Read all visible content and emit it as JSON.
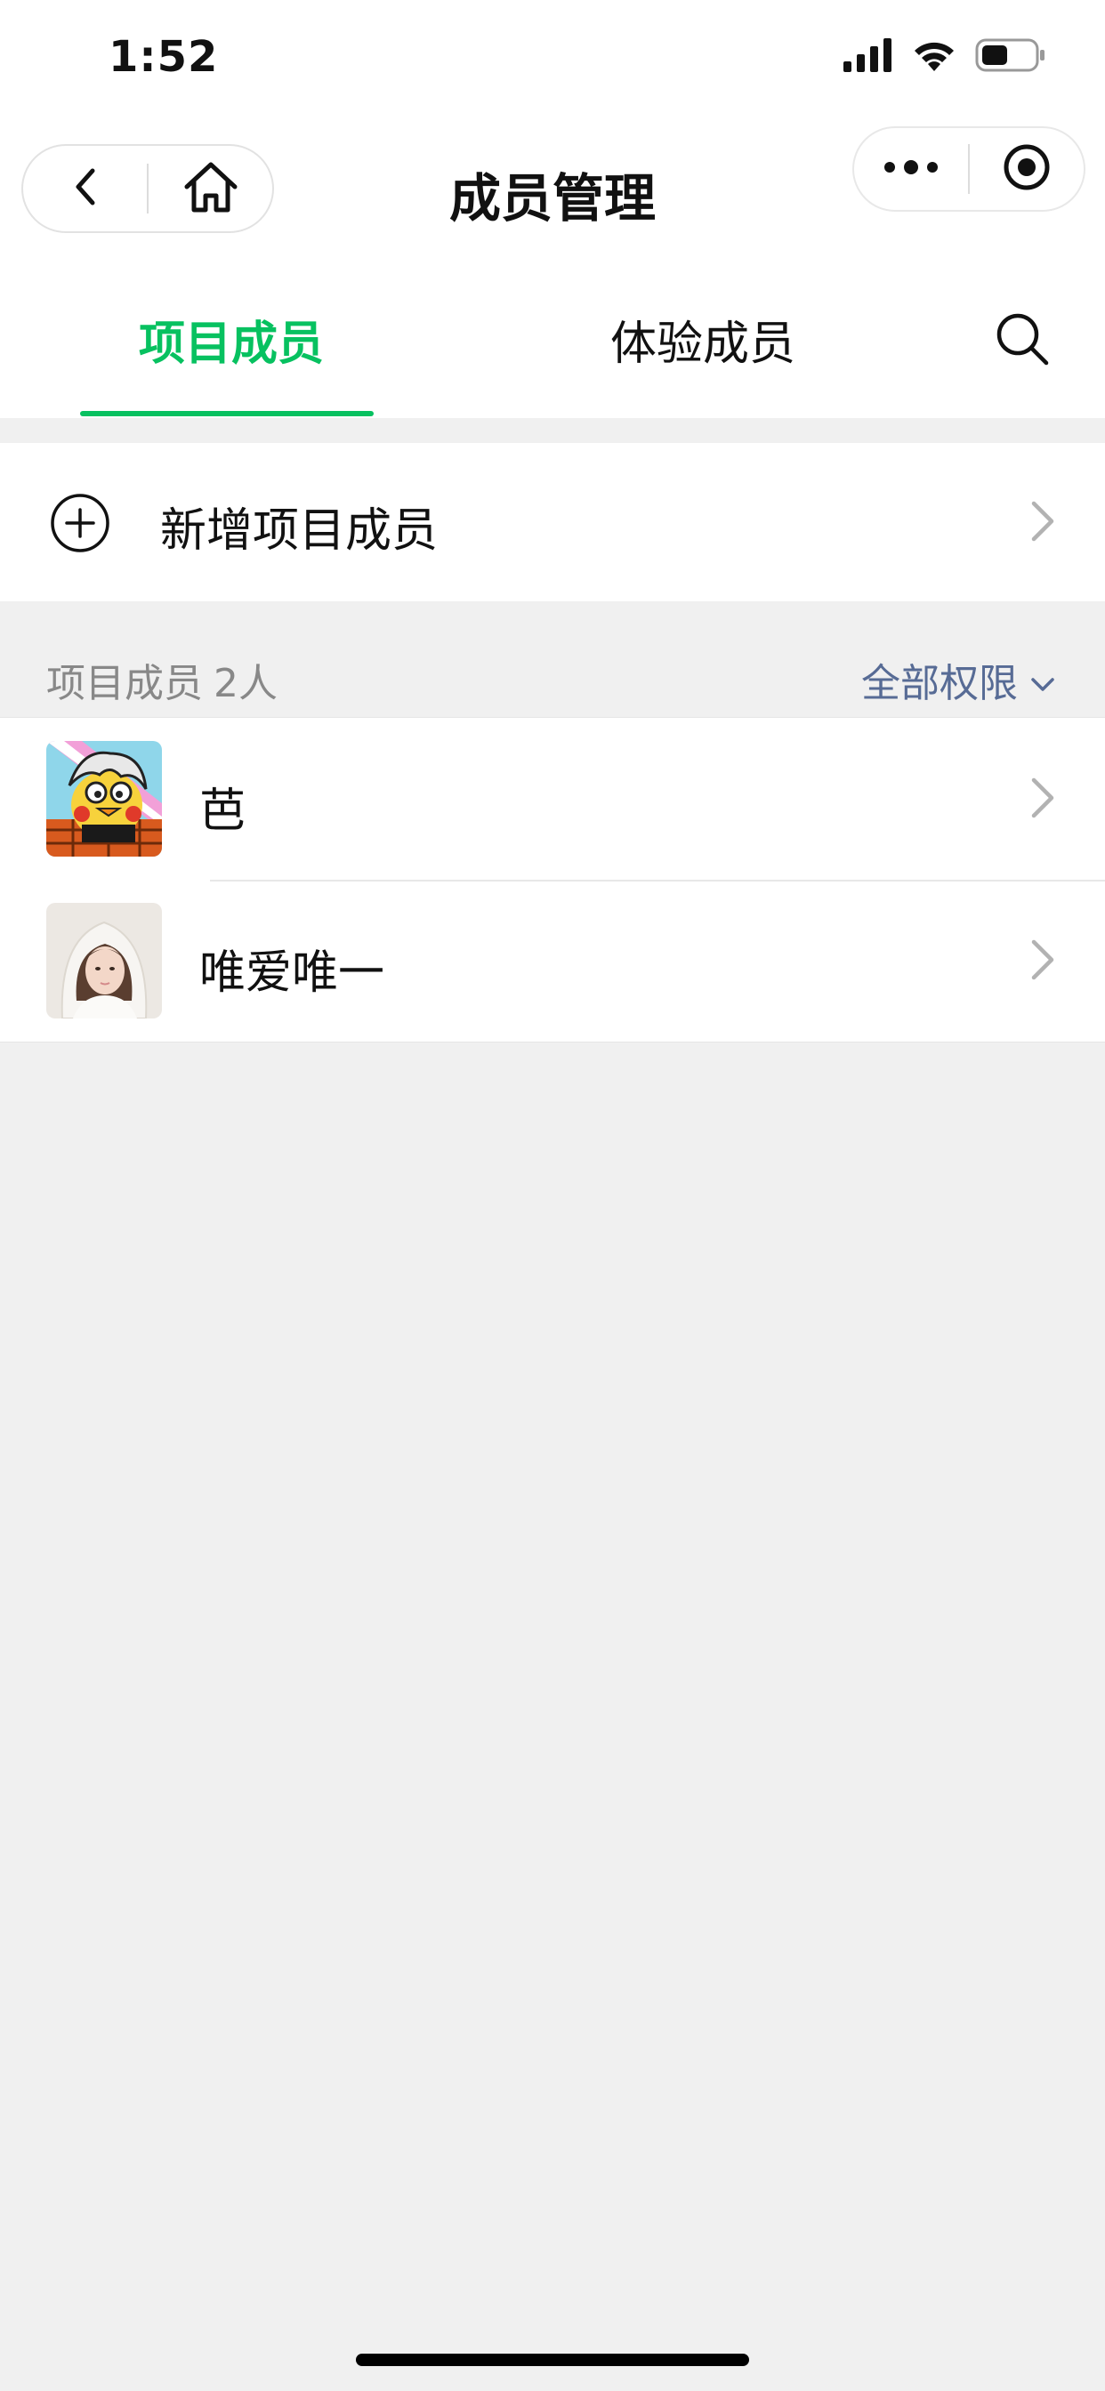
{
  "status_bar": {
    "time": "1:52",
    "icons": [
      "signal-icon",
      "wifi-icon",
      "battery-icon"
    ],
    "battery_level": 0.5
  },
  "nav_bar": {
    "title": "成员管理",
    "left_icons": [
      "back-icon",
      "home-icon"
    ],
    "right_icons": [
      "more-icon",
      "record-icon"
    ]
  },
  "tabs": {
    "items": [
      {
        "label": "项目成员",
        "active": true
      },
      {
        "label": "体验成员",
        "active": false
      }
    ],
    "search_icon": "search-icon"
  },
  "add_member": {
    "label": "新增项目成员",
    "icon": "plus-circle-icon"
  },
  "members_section": {
    "title": "项目成员",
    "count": "2人",
    "filter_label": "全部权限"
  },
  "members": [
    {
      "name": "芭",
      "avatar": "cartoon-avatar"
    },
    {
      "name": "唯爱唯一",
      "avatar": "photo-avatar"
    }
  ],
  "colors": {
    "accent": "#07c160",
    "link": "#576b95",
    "background": "#f0f0f0"
  }
}
